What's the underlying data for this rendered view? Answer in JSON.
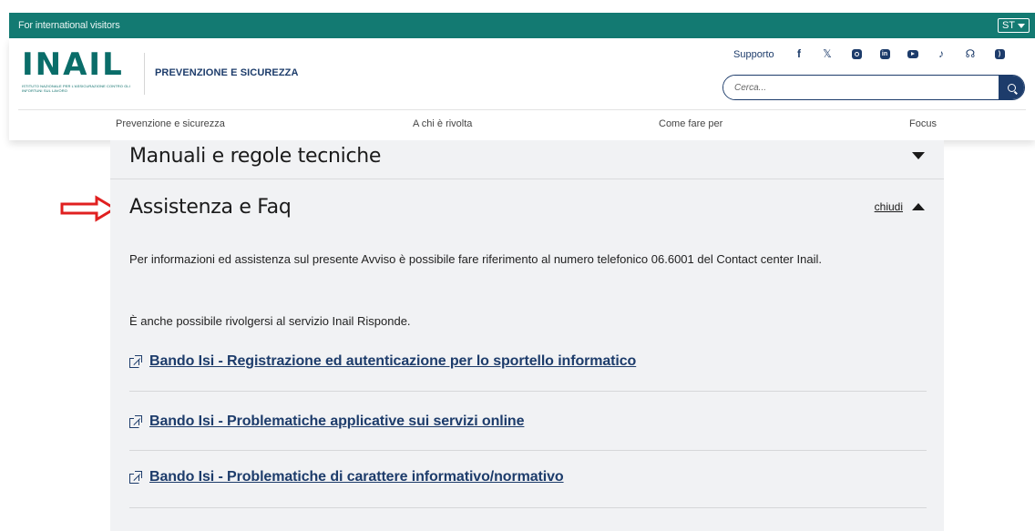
{
  "top_bar": {
    "intl_link": "For international visitors",
    "lang": "ST"
  },
  "header": {
    "logo_text": "INAIL",
    "logo_tagline": "ISTITUTO NAZIONALE PER L'ASSICURAZIONE CONTRO GLI INFORTUNI SUL LAVORO",
    "site_name": "PREVENZIONE E SICUREZZA",
    "support_label": "Supporto",
    "social_icons": [
      "facebook-icon",
      "x-icon",
      "instagram-icon",
      "linkedin-icon",
      "youtube-icon",
      "tiktok-icon",
      "podcast-icon",
      "rss-icon"
    ],
    "search_placeholder": "Cerca...",
    "nav": [
      "Prevenzione e sicurezza",
      "A chi è rivolta",
      "Come fare per",
      "Focus"
    ]
  },
  "accordion": {
    "collapsed_item": "Manuali e regole tecniche",
    "open_item": "Assistenza e Faq",
    "close_label": "chiudi",
    "paragraph_1": "Per informazioni ed assistenza sul presente Avviso è possibile fare riferimento al numero telefonico 06.6001 del Contact center Inail.",
    "paragraph_2": "È anche possibile rivolgersi al servizio Inail Risponde.",
    "links": [
      "Bando Isi - Registrazione ed autenticazione per lo sportello informatico",
      "Bando Isi - Problematiche applicative sui servizi online",
      "Bando Isi - Problematiche di carattere informativo/normativo"
    ]
  },
  "colors": {
    "top_bar": "#137a72",
    "brand_teal": "#0a6d69",
    "navy": "#1d3c6b",
    "panel_bg": "#f1f2f4",
    "annotation_red": "#e02020"
  }
}
